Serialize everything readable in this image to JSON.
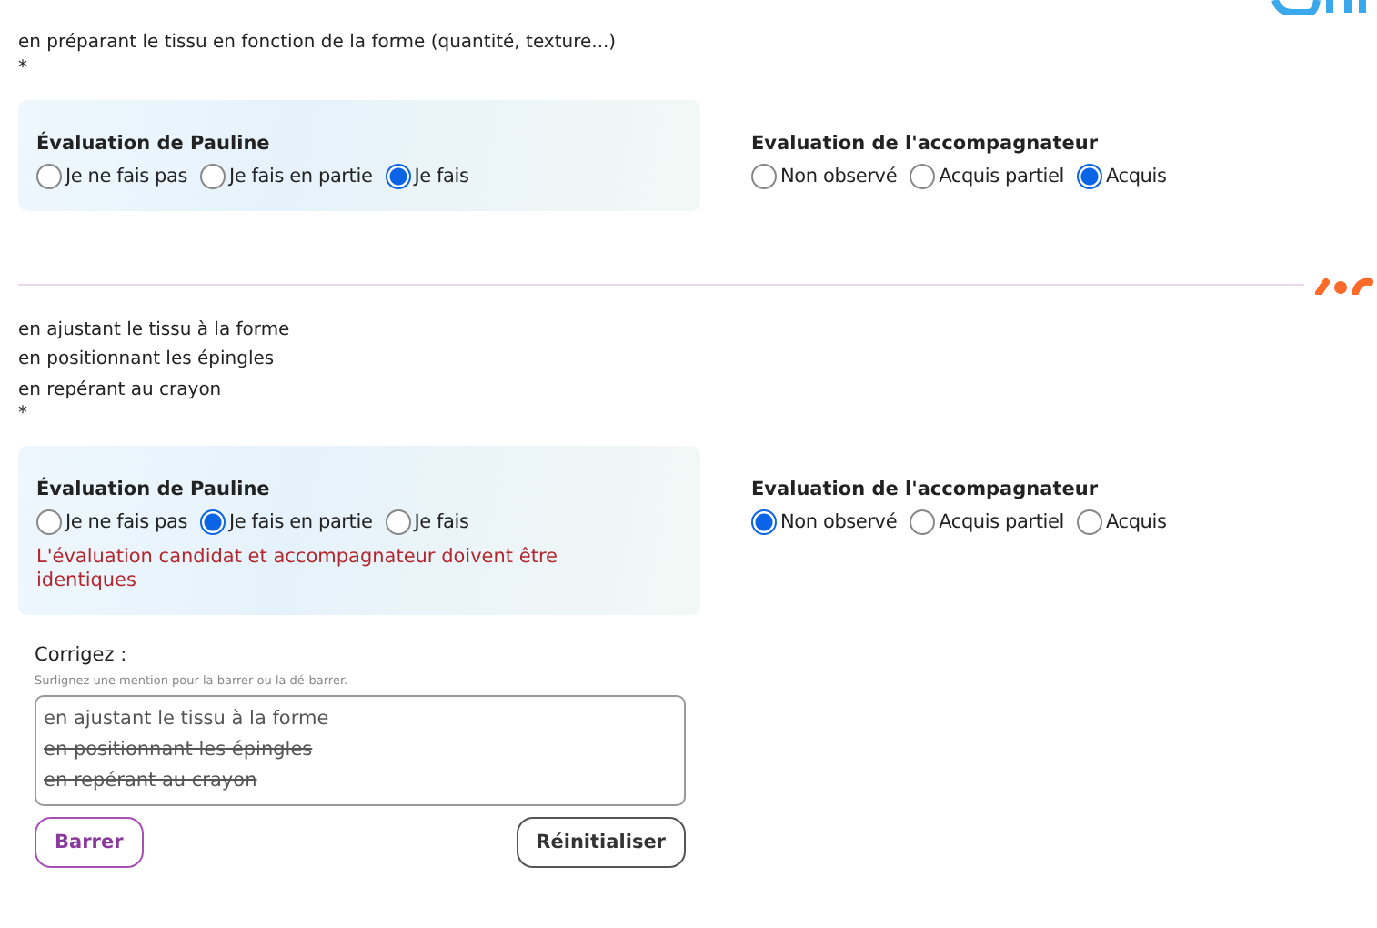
{
  "sections": [
    {
      "lines": [
        "en préparant le tissu en fonction de la forme (quantité, texture...)"
      ],
      "required_mark": "*",
      "candidate": {
        "title": "Évaluation de Pauline",
        "options": [
          {
            "label": "Je ne fais pas",
            "selected": false
          },
          {
            "label": "Je fais en partie",
            "selected": false
          },
          {
            "label": "Je fais",
            "selected": true
          }
        ]
      },
      "tutor": {
        "title": "Evaluation de l'accompagnateur",
        "options": [
          {
            "label": "Non observé",
            "selected": false
          },
          {
            "label": "Acquis partiel",
            "selected": false
          },
          {
            "label": "Acquis",
            "selected": true
          }
        ]
      }
    },
    {
      "lines": [
        "en ajustant le tissu à la forme",
        "en positionnant les épingles",
        "en repérant au crayon"
      ],
      "required_mark": "*",
      "candidate": {
        "title": "Évaluation de Pauline",
        "options": [
          {
            "label": "Je ne fais pas",
            "selected": false
          },
          {
            "label": "Je fais en partie",
            "selected": true
          },
          {
            "label": "Je fais",
            "selected": false
          }
        ],
        "error": "L'évaluation candidat et accompagnateur doivent être identiques"
      },
      "tutor": {
        "title": "Evaluation de l'accompagnateur",
        "options": [
          {
            "label": "Non observé",
            "selected": true
          },
          {
            "label": "Acquis partiel",
            "selected": false
          },
          {
            "label": "Acquis",
            "selected": false
          }
        ]
      },
      "correction": {
        "label": "Corrigez :",
        "hint": "Surlignez une mention pour la barrer ou la dé-barrer.",
        "mentions": [
          {
            "text": "en ajustant le tissu à la forme",
            "struck": false
          },
          {
            "text": "en positionnant les épingles",
            "struck": true
          },
          {
            "text": "en repérant au crayon",
            "struck": true
          }
        ],
        "strike_button": "Barrer",
        "reset_button": "Réinitialiser"
      }
    }
  ]
}
